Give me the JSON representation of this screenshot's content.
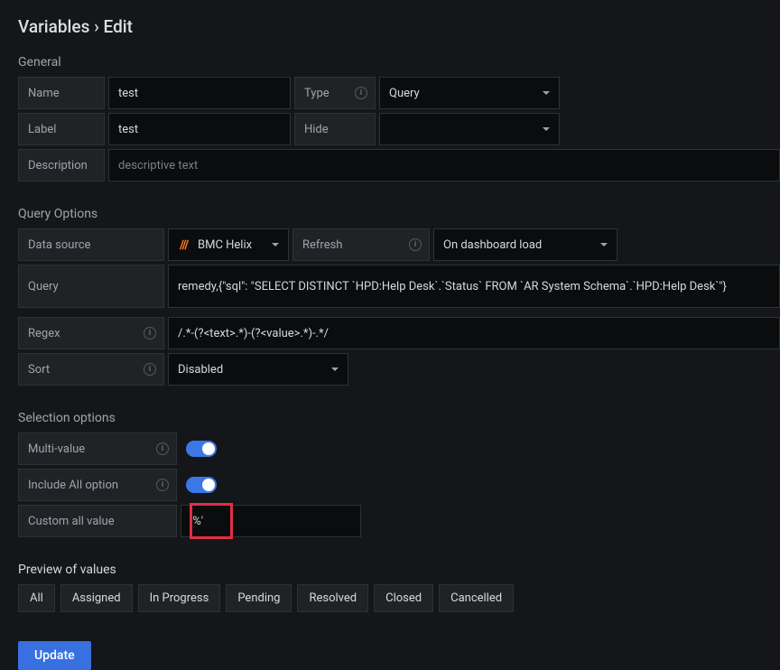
{
  "title": "Variables › Edit",
  "sections": {
    "general": "General",
    "query_options": "Query Options",
    "selection_options": "Selection options",
    "preview": "Preview of values"
  },
  "labels": {
    "name": "Name",
    "type": "Type",
    "label": "Label",
    "hide": "Hide",
    "description": "Description",
    "data_source": "Data source",
    "refresh": "Refresh",
    "query": "Query",
    "regex": "Regex",
    "sort": "Sort",
    "multi_value": "Multi-value",
    "include_all": "Include All option",
    "custom_all": "Custom all value"
  },
  "values": {
    "name": "test",
    "type": "Query",
    "label": "test",
    "hide": "",
    "description_placeholder": "descriptive text",
    "data_source": "BMC Helix",
    "refresh": "On dashboard load",
    "query": "remedy,{\"sql\": \"SELECT DISTINCT `HPD:Help Desk`.`Status` FROM `AR System Schema`.`HPD:Help Desk`\"}",
    "regex": "/.*-(?<text>.*)-(?<value>.*)-.*/",
    "sort": "Disabled",
    "multi_value": true,
    "include_all": true,
    "custom_all": "'%'"
  },
  "preview_values": [
    "All",
    "Assigned",
    "In Progress",
    "Pending",
    "Resolved",
    "Closed",
    "Cancelled"
  ],
  "buttons": {
    "update": "Update"
  }
}
